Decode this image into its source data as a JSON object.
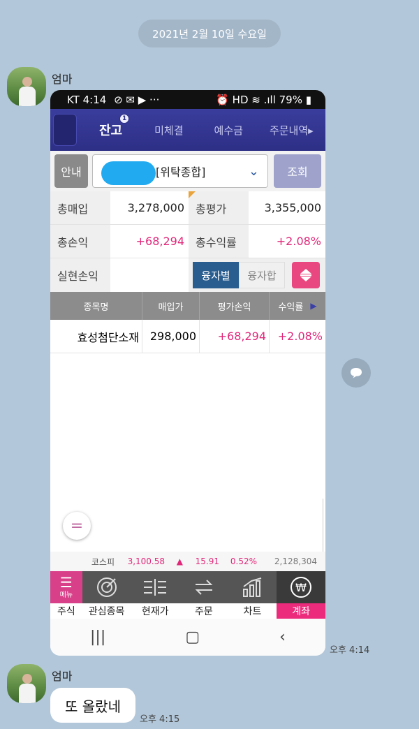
{
  "chat": {
    "date_divider": "2021년 2월 10일 수요일",
    "message1": {
      "sender": "엄마",
      "time": "오후 4:14"
    },
    "message2": {
      "sender": "엄마",
      "text": "또 올랐네",
      "time": "오후 4:15"
    }
  },
  "screenshot": {
    "status_bar": {
      "left": "KT 4:14",
      "left_icons": "⊘ ✉ ▶ ···",
      "right": "⏰ HD ≋ .ıll 79% ▮"
    },
    "tabs": [
      {
        "label": "잔고",
        "active": true,
        "badge": "1"
      },
      {
        "label": "미체결"
      },
      {
        "label": "예수금"
      },
      {
        "label": "주문내역▸"
      }
    ],
    "account": {
      "guide_button": "안내",
      "account_name": "[위탁종합]",
      "query_button": "조회"
    },
    "summary": {
      "total_purchase_label": "총매입",
      "total_purchase_value": "3,278,000",
      "total_eval_label": "총평가",
      "total_eval_value": "3,355,000",
      "total_pl_label": "총손익",
      "total_pl_value": "+68,294",
      "total_return_label": "총수익률",
      "total_return_value": "+2.08%",
      "realized_label": "실현손익",
      "segment_on": "융자별",
      "segment_off": "융자합"
    },
    "table": {
      "headers": [
        "종목명",
        "매입가",
        "평가손익",
        "수익률"
      ],
      "rows": [
        {
          "name": "효성첨단소재",
          "price": "298,000",
          "pl": "+68,294",
          "rate": "+2.08%"
        }
      ]
    },
    "ticker": {
      "index_name": "코스피",
      "index_value": "3,100.58",
      "arrow": "▲",
      "change": "15.91",
      "change_pct": "0.52%",
      "volume": "2,128,304"
    },
    "bottom_nav": [
      {
        "label": "주식",
        "icon": "menu-icon",
        "top": "메뉴"
      },
      {
        "label": "관심종목",
        "icon": "watchlist-icon"
      },
      {
        "label": "현재가",
        "icon": "current-price-icon"
      },
      {
        "label": "주문",
        "icon": "order-icon"
      },
      {
        "label": "차트",
        "icon": "chart-icon"
      },
      {
        "label": "계좌",
        "icon": "account-won-icon"
      }
    ],
    "colors": {
      "tab_bar": "#2d2f86",
      "positive": "#e0287a",
      "active_nav": "#ed2b7c"
    }
  }
}
